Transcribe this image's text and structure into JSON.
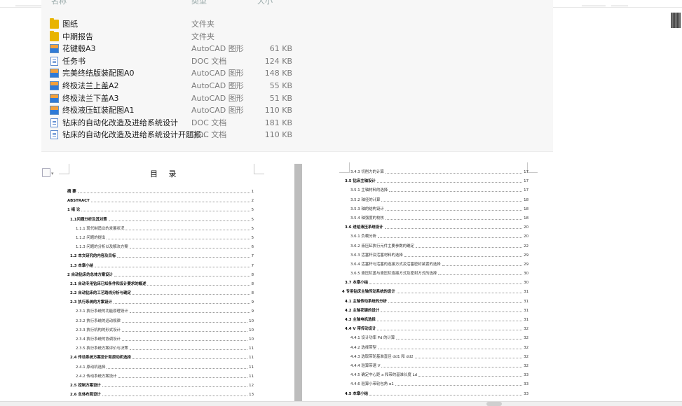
{
  "explorer": {
    "header": {
      "name": "名称",
      "type": "类型",
      "size": "大小"
    },
    "files": [
      {
        "icon": "folder-icon",
        "name": "图纸",
        "type": "文件夹",
        "size": ""
      },
      {
        "icon": "folder-icon",
        "name": "中期报告",
        "type": "文件夹",
        "size": ""
      },
      {
        "icon": "autocad-file-icon",
        "name": "花键毂A3",
        "type": "AutoCAD 图形",
        "size": "61 KB"
      },
      {
        "icon": "doc-file-icon",
        "name": "任务书",
        "type": "DOC 文档",
        "size": "124 KB"
      },
      {
        "icon": "autocad-file-icon",
        "name": "完美终结版装配图A0",
        "type": "AutoCAD 图形",
        "size": "148 KB"
      },
      {
        "icon": "autocad-file-icon",
        "name": "终极法兰上盖A2",
        "type": "AutoCAD 图形",
        "size": "55 KB"
      },
      {
        "icon": "autocad-file-icon",
        "name": "终极法兰下盖A3",
        "type": "AutoCAD 图形",
        "size": "51 KB"
      },
      {
        "icon": "autocad-file-icon",
        "name": "终极液压缸装配图A1",
        "type": "AutoCAD 图形",
        "size": "110 KB"
      },
      {
        "icon": "doc-file-icon",
        "name": "钻床的自动化改造及进给系统设计",
        "type": "DOC 文档",
        "size": "181 KB"
      },
      {
        "icon": "doc-file-icon",
        "name": "钻床的自动化改造及进给系统设计开题报...",
        "type": "DOC 文档",
        "size": "110 KB"
      }
    ]
  },
  "document": {
    "toc_title": "目 录",
    "left_entries": [
      {
        "text": "摘 要",
        "page": "1",
        "level": 0,
        "bold": true
      },
      {
        "text": "ABSTRACT",
        "page": "2",
        "level": 0,
        "bold": true
      },
      {
        "text": "1 绪 论",
        "page": "5",
        "level": 0,
        "bold": true
      },
      {
        "text": "1.1问题分析及其对策",
        "page": "5",
        "level": 1,
        "bold": true
      },
      {
        "text": "1.1.1 现代制造业的发展状况",
        "page": "5",
        "level": 2,
        "bold": false
      },
      {
        "text": "1.1.2 问题的提出",
        "page": "5",
        "level": 2,
        "bold": false
      },
      {
        "text": "1.1.3 问题的分析以及解决方案",
        "page": "6",
        "level": 2,
        "bold": false
      },
      {
        "text": "1.2 本文研究的内容及目标",
        "page": "7",
        "level": 1,
        "bold": true
      },
      {
        "text": "1.3 本章小结",
        "page": "7",
        "level": 1,
        "bold": true
      },
      {
        "text": "2 自动钻床的总体方案设计",
        "page": "8",
        "level": 0,
        "bold": true
      },
      {
        "text": "2.1 自动专用钻床已知条件和设计要求的概述",
        "page": "8",
        "level": 1,
        "bold": true
      },
      {
        "text": "2.2 自动钻床的工艺路线分析与确定",
        "page": "8",
        "level": 1,
        "bold": true
      },
      {
        "text": "2.3 执行系统的方案设计",
        "page": "9",
        "level": 1,
        "bold": true
      },
      {
        "text": "2.3.1 执行系统的功能原理设计",
        "page": "9",
        "level": 2,
        "bold": false
      },
      {
        "text": "2.3.2 执行系统的运动规律",
        "page": "10",
        "level": 2,
        "bold": false
      },
      {
        "text": "2.3.3 执行机构的形式设计",
        "page": "10",
        "level": 2,
        "bold": false
      },
      {
        "text": "2.3.4 执行系统的协调设计",
        "page": "10",
        "level": 2,
        "bold": false
      },
      {
        "text": "2.3.5 执行系统方案评价与决策",
        "page": "11",
        "level": 2,
        "bold": false
      },
      {
        "text": "2.4 传动系统方案设计和原动机选择",
        "page": "11",
        "level": 1,
        "bold": true
      },
      {
        "text": "2.4.1 原动机选择",
        "page": "11",
        "level": 2,
        "bold": false
      },
      {
        "text": "2.4.2 传动系统方案设计",
        "page": "11",
        "level": 2,
        "bold": false
      },
      {
        "text": "2.5 控制方案设计",
        "page": "12",
        "level": 1,
        "bold": true
      },
      {
        "text": "2.6 总体布局设计",
        "page": "13",
        "level": 1,
        "bold": true
      }
    ],
    "right_entries": [
      {
        "text": "3.4.3 切削力的计算",
        "page": "17",
        "level": 2,
        "bold": false
      },
      {
        "text": "3.5 钻床主轴设计",
        "page": "17",
        "level": 1,
        "bold": true
      },
      {
        "text": "3.5.1 主轴材料的选择",
        "page": "17",
        "level": 2,
        "bold": false
      },
      {
        "text": "3.5.2 轴径的计算",
        "page": "18",
        "level": 2,
        "bold": false
      },
      {
        "text": "3.5.3 轴的结构设计",
        "page": "18",
        "level": 2,
        "bold": false
      },
      {
        "text": "3.5.4 轴强度的校核",
        "page": "18",
        "level": 2,
        "bold": false
      },
      {
        "text": "3.6 进给液压系统设计",
        "page": "20",
        "level": 1,
        "bold": true
      },
      {
        "text": "3.6.1 负载分析",
        "page": "20",
        "level": 2,
        "bold": false
      },
      {
        "text": "3.6.2 液压缸执行元件主要参数的确定",
        "page": "22",
        "level": 2,
        "bold": false
      },
      {
        "text": "3.6.3 活塞杆及活塞材料的选择",
        "page": "29",
        "level": 2,
        "bold": false
      },
      {
        "text": "3.6.4 活塞杆与活塞的连接方式及活塞密封装置的选择",
        "page": "29",
        "level": 2,
        "bold": false
      },
      {
        "text": "3.6.5 液压缸盖与液压缸连接方式及密封方式的选择",
        "page": "30",
        "level": 2,
        "bold": false
      },
      {
        "text": "3.7 本章小结",
        "page": "30",
        "level": 1,
        "bold": true
      },
      {
        "text": "4 专用钻床主轴传动系统的设计",
        "page": "31",
        "level": 0,
        "bold": true
      },
      {
        "text": "4.1 主轴传动系统的分析",
        "page": "31",
        "level": 1,
        "bold": true
      },
      {
        "text": "4.2 主轴花键的设计",
        "page": "31",
        "level": 1,
        "bold": true
      },
      {
        "text": "4.3 主轴电机选择",
        "page": "31",
        "level": 1,
        "bold": true
      },
      {
        "text": "4.4 V 带传动设计",
        "page": "32",
        "level": 1,
        "bold": true
      },
      {
        "text": "4.4.1 设计功率 Pd 的计算",
        "page": "32",
        "level": 2,
        "bold": false
      },
      {
        "text": "4.4.2 选择带型",
        "page": "32",
        "level": 2,
        "bold": false
      },
      {
        "text": "4.4.3 选取带轮基准直径 dd1 和 dd2",
        "page": "32",
        "level": 2,
        "bold": false
      },
      {
        "text": "4.4.4 验算带速 V",
        "page": "32",
        "level": 2,
        "bold": false
      },
      {
        "text": "4.4.5 确定中心距 a 和带的基准长度 Ld",
        "page": "33",
        "level": 2,
        "bold": false
      },
      {
        "text": "4.4.6 验算小带轮包角 α1",
        "page": "33",
        "level": 2,
        "bold": false
      },
      {
        "text": "4.5 本章小结",
        "page": "33",
        "level": 1,
        "bold": true
      }
    ]
  }
}
